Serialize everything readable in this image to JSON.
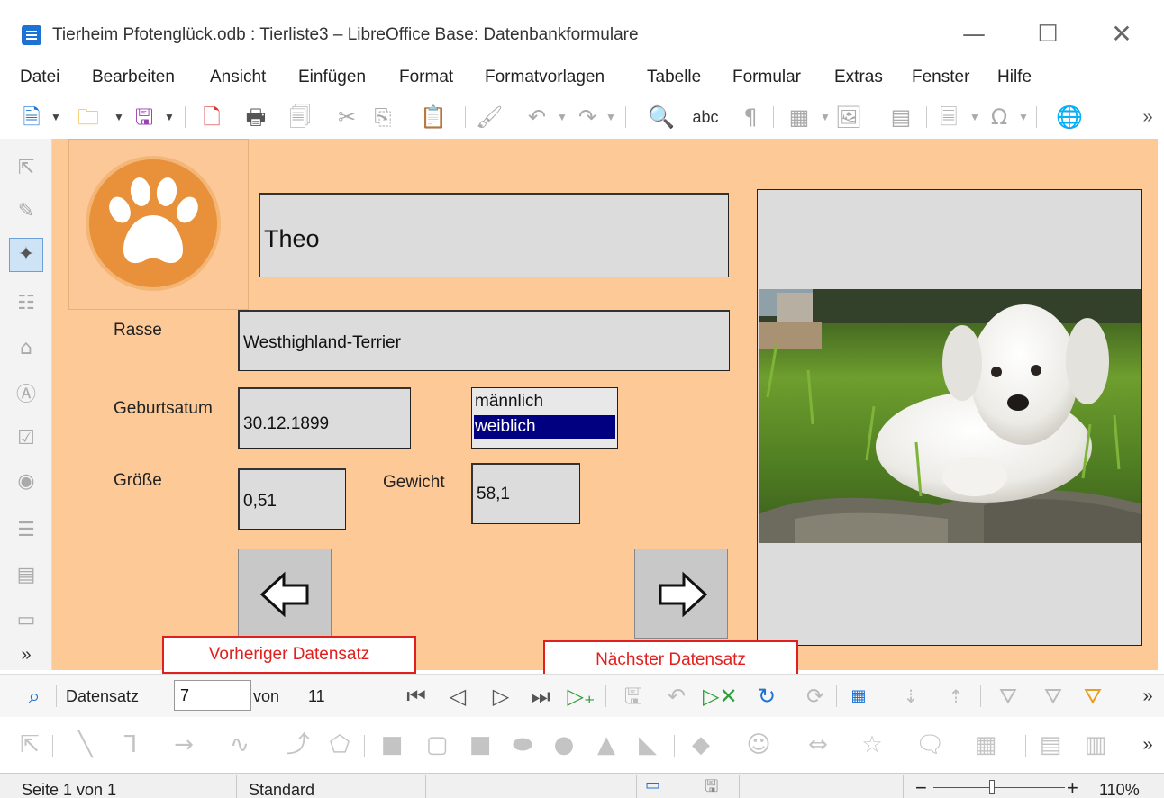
{
  "window": {
    "title": "Tierheim Pfotenglück.odb : Tierliste3 – LibreOffice Base: Datenbankformulare",
    "minimize": "—",
    "maximize": "☐",
    "close": "✕"
  },
  "menu": [
    "Datei",
    "Bearbeiten",
    "Ansicht",
    "Einfügen",
    "Format",
    "Formatvorlagen",
    "Tabelle",
    "Formular",
    "Extras",
    "Fenster",
    "Hilfe"
  ],
  "toolbar": {
    "overflow": "»",
    "spelling_label": "abc"
  },
  "left_toolbar": {
    "overflow": "»"
  },
  "form": {
    "name_value": "Theo",
    "rasse_label": "Rasse",
    "rasse_value": "Westhighland-Terrier",
    "birth_label": "Geburtsatum",
    "birth_value": "30.12.1899",
    "sex_options": [
      "männlich",
      "weiblich"
    ],
    "sex_selected": "weiblich",
    "size_label": "Größe",
    "size_value": "0,51",
    "weight_label": "Gewicht",
    "weight_value": "58,1"
  },
  "callouts": {
    "prev": "Vorheriger Datensatz",
    "next": "Nächster Datensatz"
  },
  "record_nav": {
    "label": "Datensatz",
    "current": "7",
    "of": "von",
    "total": "11",
    "overflow": "»"
  },
  "drawbar": {
    "overflow": "»"
  },
  "status": {
    "page": "Seite 1 von 1",
    "style": "Standard",
    "zoom": "110%",
    "zoom_minus": "−",
    "zoom_plus": "+"
  },
  "colors": {
    "form_background": "#fdc996",
    "selection": "#000080",
    "callout": "#e0201e",
    "logo": "#e8913a"
  }
}
